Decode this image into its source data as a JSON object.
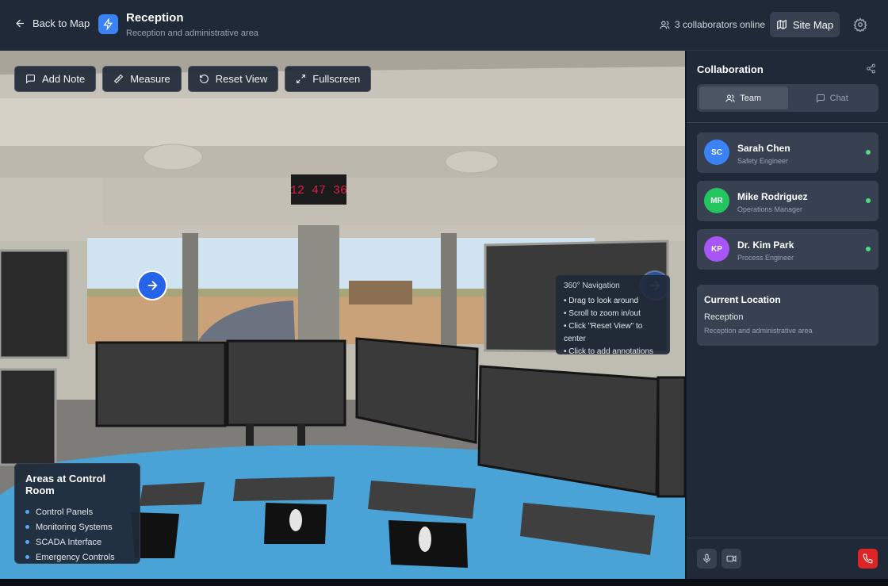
{
  "header": {
    "back_label": "Back to Map",
    "title": "Reception",
    "subtitle": "Reception and administrative area",
    "collaborators": "3 collaborators online",
    "site_map_label": "Site Map"
  },
  "toolbar": {
    "add_note": "Add Note",
    "measure": "Measure",
    "reset_view": "Reset View",
    "fullscreen": "Fullscreen"
  },
  "scene": {
    "clock": "12 47 36"
  },
  "nav_help": {
    "title": "360° Navigation",
    "items": [
      "• Drag to look around",
      "• Scroll to zoom in/out",
      "• Click \"Reset View\" to center",
      "• Click to add annotations"
    ]
  },
  "areas": {
    "title": "Areas at Control Room",
    "items": [
      "Control Panels",
      "Monitoring Systems",
      "SCADA Interface",
      "Emergency Controls"
    ]
  },
  "sidebar": {
    "title": "Collaboration",
    "tabs": [
      {
        "label": "Team"
      },
      {
        "label": "Chat"
      }
    ],
    "members": [
      {
        "initials": "SC",
        "name": "Sarah Chen",
        "role": "Safety Engineer",
        "color": "#3b82f6"
      },
      {
        "initials": "MR",
        "name": "Mike Rodriguez",
        "role": "Operations Manager",
        "color": "#22c55e"
      },
      {
        "initials": "KP",
        "name": "Dr. Kim Park",
        "role": "Process Engineer",
        "color": "#a855f7"
      }
    ],
    "location": {
      "title": "Current Location",
      "name": "Reception",
      "description": "Reception and administrative area"
    }
  },
  "colors": {
    "accent": "#3b82f6",
    "online": "#4ade80",
    "end_call": "#dc2626"
  }
}
